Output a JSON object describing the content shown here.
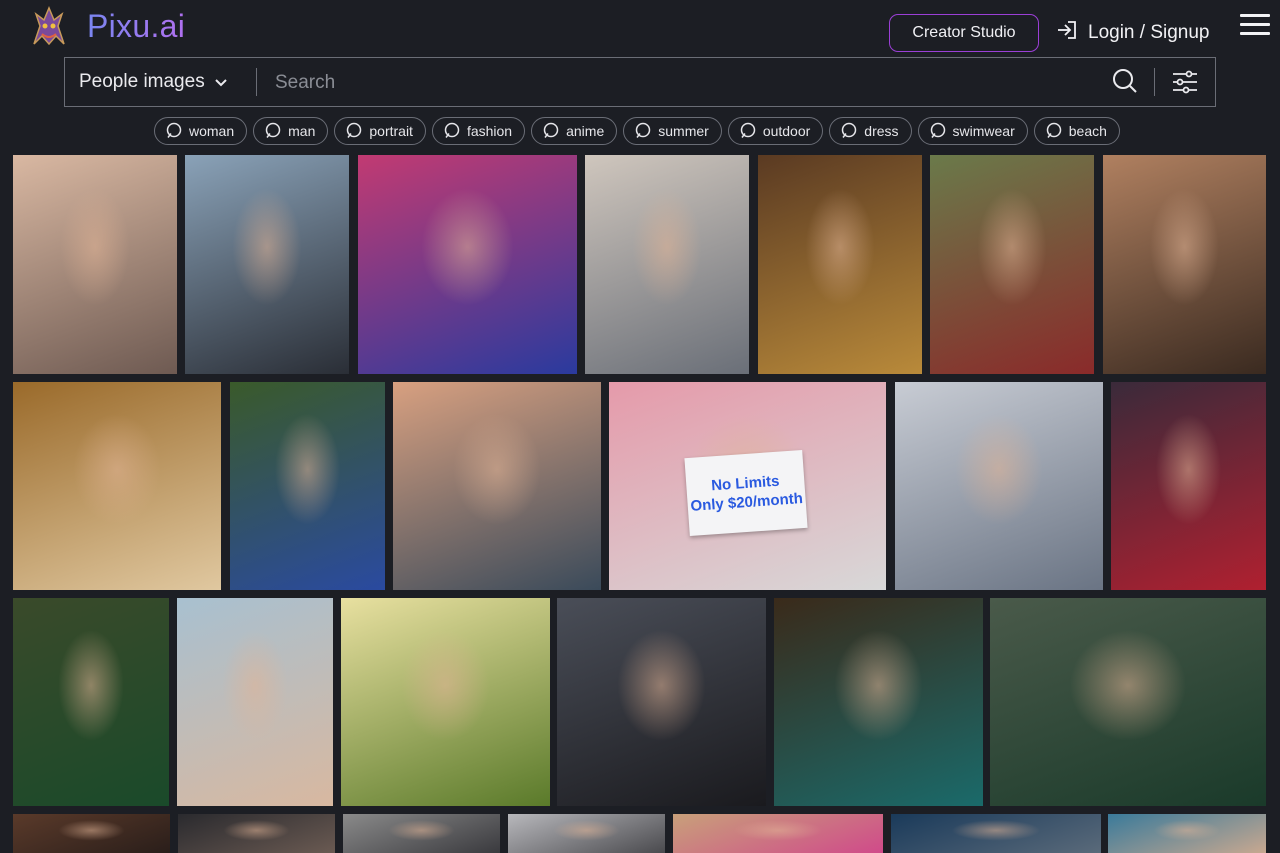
{
  "header": {
    "brand": "Pixu.ai",
    "creator_studio": "Creator Studio",
    "login": "Login / Signup"
  },
  "search": {
    "category": "People images",
    "placeholder": "Search"
  },
  "tags": [
    "woman",
    "man",
    "portrait",
    "fashion",
    "anime",
    "summer",
    "outdoor",
    "dress",
    "swimwear",
    "beach"
  ],
  "gallery": {
    "rows": [
      [
        {
          "subject": "blonde woman in black lace lingerie on bed",
          "c1": "#d9b8a2",
          "c2": "#6e5a52"
        },
        {
          "subject": "woman in black blazer by city window",
          "c1": "#8aa2b8",
          "c2": "#2a2e36"
        },
        {
          "subject": "man in pink and blue suit",
          "c1": "#c23a72",
          "c2": "#2a3a9e"
        },
        {
          "subject": "woman in navy bikini by window",
          "c1": "#cfc6bd",
          "c2": "#6a6f78"
        },
        {
          "subject": "woman in gold sequin dress",
          "c1": "#5a3a22",
          "c2": "#b98a3a"
        },
        {
          "subject": "woman in red folk dress by cabin",
          "c1": "#6a7a4a",
          "c2": "#8a2a2a"
        },
        {
          "subject": "shirtless muscular man",
          "c1": "#b08060",
          "c2": "#3a2a20"
        }
      ],
      [
        {
          "subject": "red-haired woman with flower crown",
          "c1": "#9a6a2a",
          "c2": "#e0c8a0"
        },
        {
          "subject": "woman in blue sportswear on forest trail",
          "c1": "#3a5a2a",
          "c2": "#2a4aa0"
        },
        {
          "subject": "woman in white tee on seaside pier",
          "c1": "#d8a080",
          "c2": "#3a4a5a"
        },
        {
          "subject": "woman holding No Limits sign",
          "c1": "#e59aaa",
          "c2": "#d8d8d8"
        },
        {
          "subject": "winged armored warrior",
          "c1": "#c8ccd4",
          "c2": "#6a7484"
        },
        {
          "subject": "woman in black lingerie in studio",
          "c1": "#3a2a3a",
          "c2": "#b02030"
        }
      ],
      [
        {
          "subject": "woman in green satin dress",
          "c1": "#3a4a2a",
          "c2": "#1a4a2a"
        },
        {
          "subject": "woman in pink bikini on beach",
          "c1": "#a8c0d0",
          "c2": "#d8b8a0"
        },
        {
          "subject": "woman walking in sunny meadow",
          "c1": "#e8e0a0",
          "c2": "#5a7a2a"
        },
        {
          "subject": "anime style girl with white twin tails",
          "c1": "#4a4e58",
          "c2": "#1a1a1e"
        },
        {
          "subject": "woman in teal sequin top with bokeh",
          "c1": "#3a2a1a",
          "c2": "#1a6a6a"
        },
        {
          "subject": "woman in green gown by waterfall",
          "c1": "#4a5a4a",
          "c2": "#1a3a2a"
        }
      ],
      [
        {
          "subject": "portrait",
          "c1": "#5a3a2a",
          "c2": "#2a1e1a"
        },
        {
          "subject": "portrait",
          "c1": "#2a2a2e",
          "c2": "#6a5a52"
        },
        {
          "subject": "portrait",
          "c1": "#8a8a8a",
          "c2": "#3a3a3e"
        },
        {
          "subject": "portrait",
          "c1": "#b8b8bc",
          "c2": "#4a4a4e"
        },
        {
          "subject": "portrait",
          "c1": "#c8a07a",
          "c2": "#d04a8a"
        },
        {
          "subject": "portrait",
          "c1": "#1a3a5a",
          "c2": "#5a6a7a"
        },
        {
          "subject": "portrait",
          "c1": "#3a7a9a",
          "c2": "#c8a890"
        }
      ]
    ],
    "sign_line1": "No Limits",
    "sign_line2": "Only $20/month"
  }
}
